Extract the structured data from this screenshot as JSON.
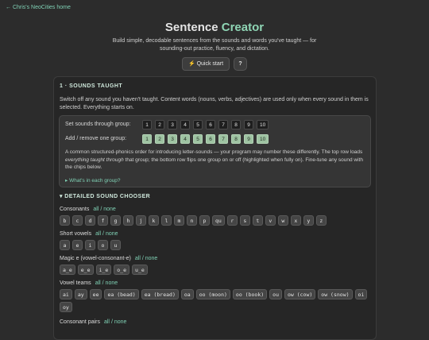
{
  "home_link": "← Chris's NeoCities home",
  "title": {
    "main": "Sentence ",
    "accent": "Creator"
  },
  "subtitle": "Build simple, decodable sentences from the sounds and words you've taught — for sounding-out practice, fluency, and dictation.",
  "quick_start": "⚡ Quick start",
  "help": "?",
  "section1": {
    "heading": "1 · SOUNDS TAUGHT",
    "intro": "Switch off any sound you haven't taught. Content words (nouns, verbs, adjectives) are used only when every sound in them is selected. Everything starts on.",
    "set_label": "Set sounds through group:",
    "remove_label": "Add / remove one group:",
    "groups": [
      "1",
      "2",
      "3",
      "4",
      "5",
      "6",
      "7",
      "8",
      "9",
      "10"
    ],
    "explanation_a": "A common structured-phonics order for introducing letter-sounds — your program may number these differently. The top row loads ",
    "explanation_em": "everything taught through",
    "explanation_b": " that group; the bottom row flips one group on or off (highlighted when fully on). Fine-tune any sound with the chips below.",
    "whats_in": "▸ What's in each group?"
  },
  "chooser": {
    "heading": "▾ DETAILED SOUND CHOOSER",
    "all": "all",
    "none": "none",
    "groups": [
      {
        "label": "Consonants",
        "chips": [
          "b",
          "c",
          "d",
          "f",
          "g",
          "h",
          "j",
          "k",
          "l",
          "m",
          "n",
          "p",
          "qu",
          "r",
          "s",
          "t",
          "v",
          "w",
          "x",
          "y",
          "z"
        ]
      },
      {
        "label": "Short vowels",
        "chips": [
          "a",
          "e",
          "i",
          "o",
          "u"
        ]
      },
      {
        "label": "Magic e (vowel-consonant-e)",
        "chips": [
          "a_e",
          "e_e",
          "i_e",
          "o_e",
          "u_e"
        ]
      },
      {
        "label": "Vowel teams",
        "chips": [
          "ai",
          "ay",
          "ee",
          "ea (bead)",
          "ea (bread)",
          "oa",
          "oo (moon)",
          "oo (book)",
          "ou",
          "ow (cow)",
          "ow (snow)",
          "oi",
          "oy"
        ]
      },
      {
        "label": "Consonant pairs",
        "chips": []
      }
    ]
  }
}
